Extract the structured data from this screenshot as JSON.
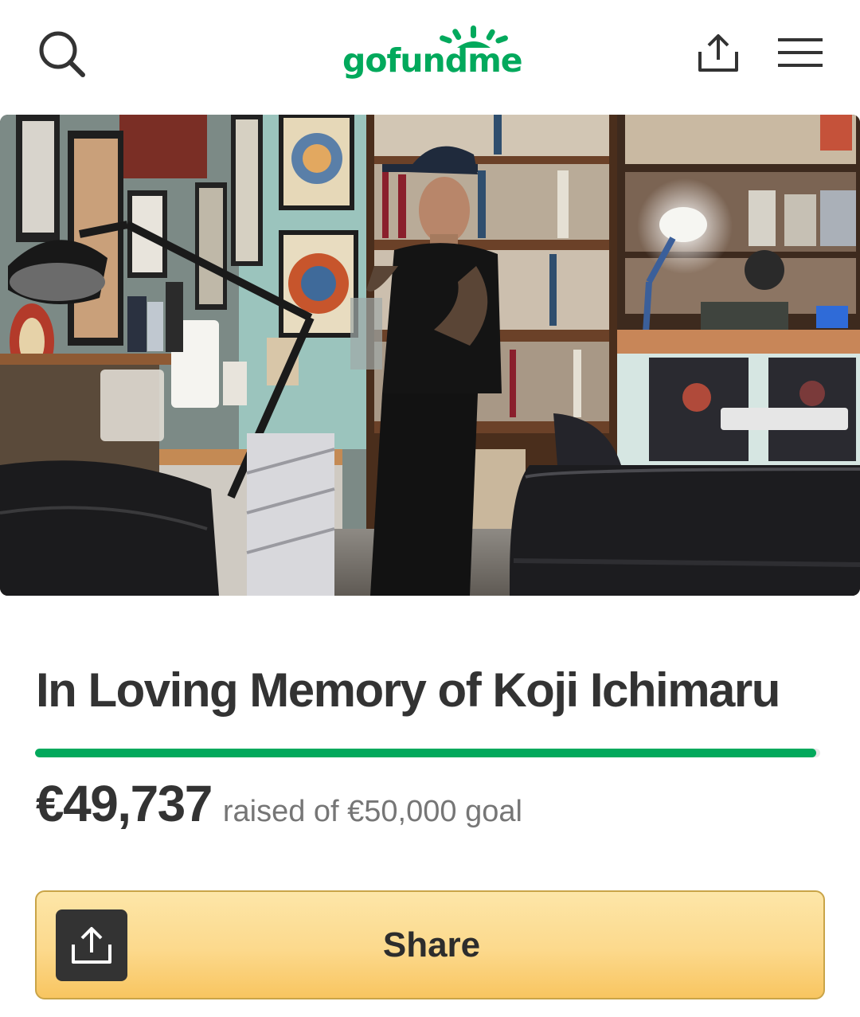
{
  "header": {
    "logo_text": "gofundme",
    "icons": {
      "search": "search-icon",
      "share": "share-icon",
      "menu": "hamburger-menu-icon"
    }
  },
  "campaign": {
    "photo_alt": "Tattoo artist working in a studio with bookshelves",
    "title": "In Loving Memory of Koji Ichimaru",
    "raised_amount": "€49,737",
    "goal_text": "raised of €50,000 goal",
    "progress_percent": 99.5
  },
  "actions": {
    "share_label": "Share"
  },
  "colors": {
    "brand_green": "#02a95c",
    "text_dark": "#333333",
    "text_muted": "#767676",
    "share_button_top": "#fde6a8",
    "share_button_bottom": "#f8c560",
    "share_button_border": "#c9a448"
  }
}
